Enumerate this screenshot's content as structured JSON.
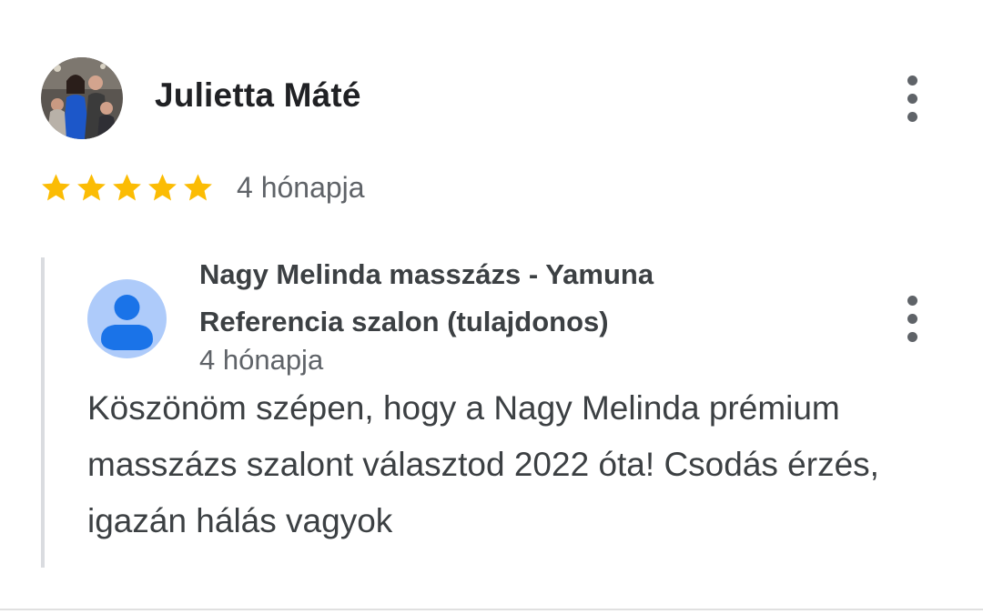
{
  "review": {
    "reviewer_name": "Julietta Máté",
    "rating": 5,
    "rating_max": 5,
    "time": "4 hónapja",
    "avatar": "profile-photo",
    "menu_icon": "more-vert-icon"
  },
  "reply": {
    "owner_name": "Nagy Melinda masszázs - Yamuna Referencia szalon (tulajdonos)",
    "time": "4 hónapja",
    "text": "Köszönöm szépen, hogy a Nagy Melinda prémium masszázs szalont választod 2022 óta! Csodás érzés, igazán hálás vagyok",
    "avatar": "default-person-icon",
    "menu_icon": "more-vert-icon"
  },
  "colors": {
    "star": "#fbbc04",
    "avatar_bg": "#aecbfa",
    "avatar_fg": "#1a73e8",
    "reply_bar": "#dadce0"
  }
}
